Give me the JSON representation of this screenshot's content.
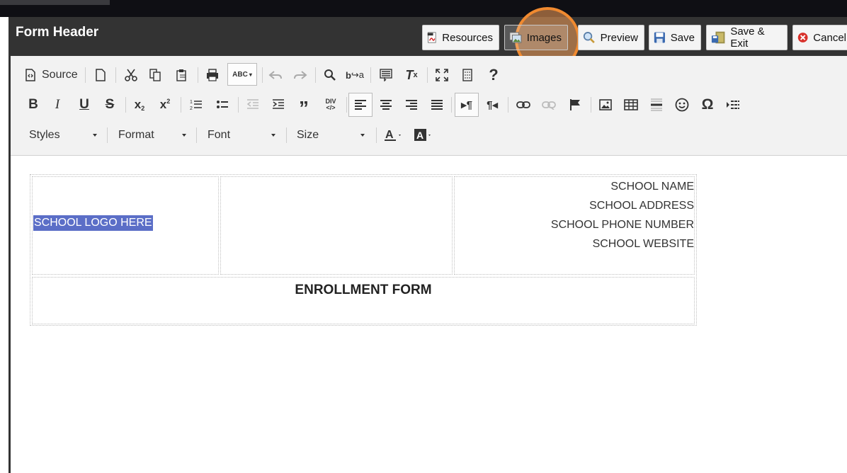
{
  "window": {
    "title": "Form Header"
  },
  "header_buttons": {
    "resources": "Resources",
    "images": "Images",
    "preview": "Preview",
    "save": "Save",
    "save_exit": "Save & Exit",
    "cancel": "Cancel"
  },
  "toolbar": {
    "source_label": "Source",
    "styles": "Styles",
    "format": "Format",
    "font": "Font",
    "size": "Size",
    "spellcheck_label": "ABC",
    "div_label": "DIV"
  },
  "content": {
    "logo_placeholder": "SCHOOL LOGO HERE",
    "school_name": "SCHOOL NAME",
    "school_address": "SCHOOL ADDRESS",
    "school_phone": "SCHOOL PHONE NUMBER",
    "school_website": "SCHOOL WEBSITE",
    "form_title": "ENROLLMENT FORM"
  },
  "colors": {
    "header_bg": "#333333",
    "highlight_ring": "#f08a30",
    "selection": "#5b6ec7",
    "toolbar_bg": "#f2f2f2"
  },
  "icons": [
    "pdf-icon",
    "images-icon",
    "magnifier-icon",
    "floppy-disk-icon",
    "save-exit-icon",
    "cancel-icon"
  ]
}
